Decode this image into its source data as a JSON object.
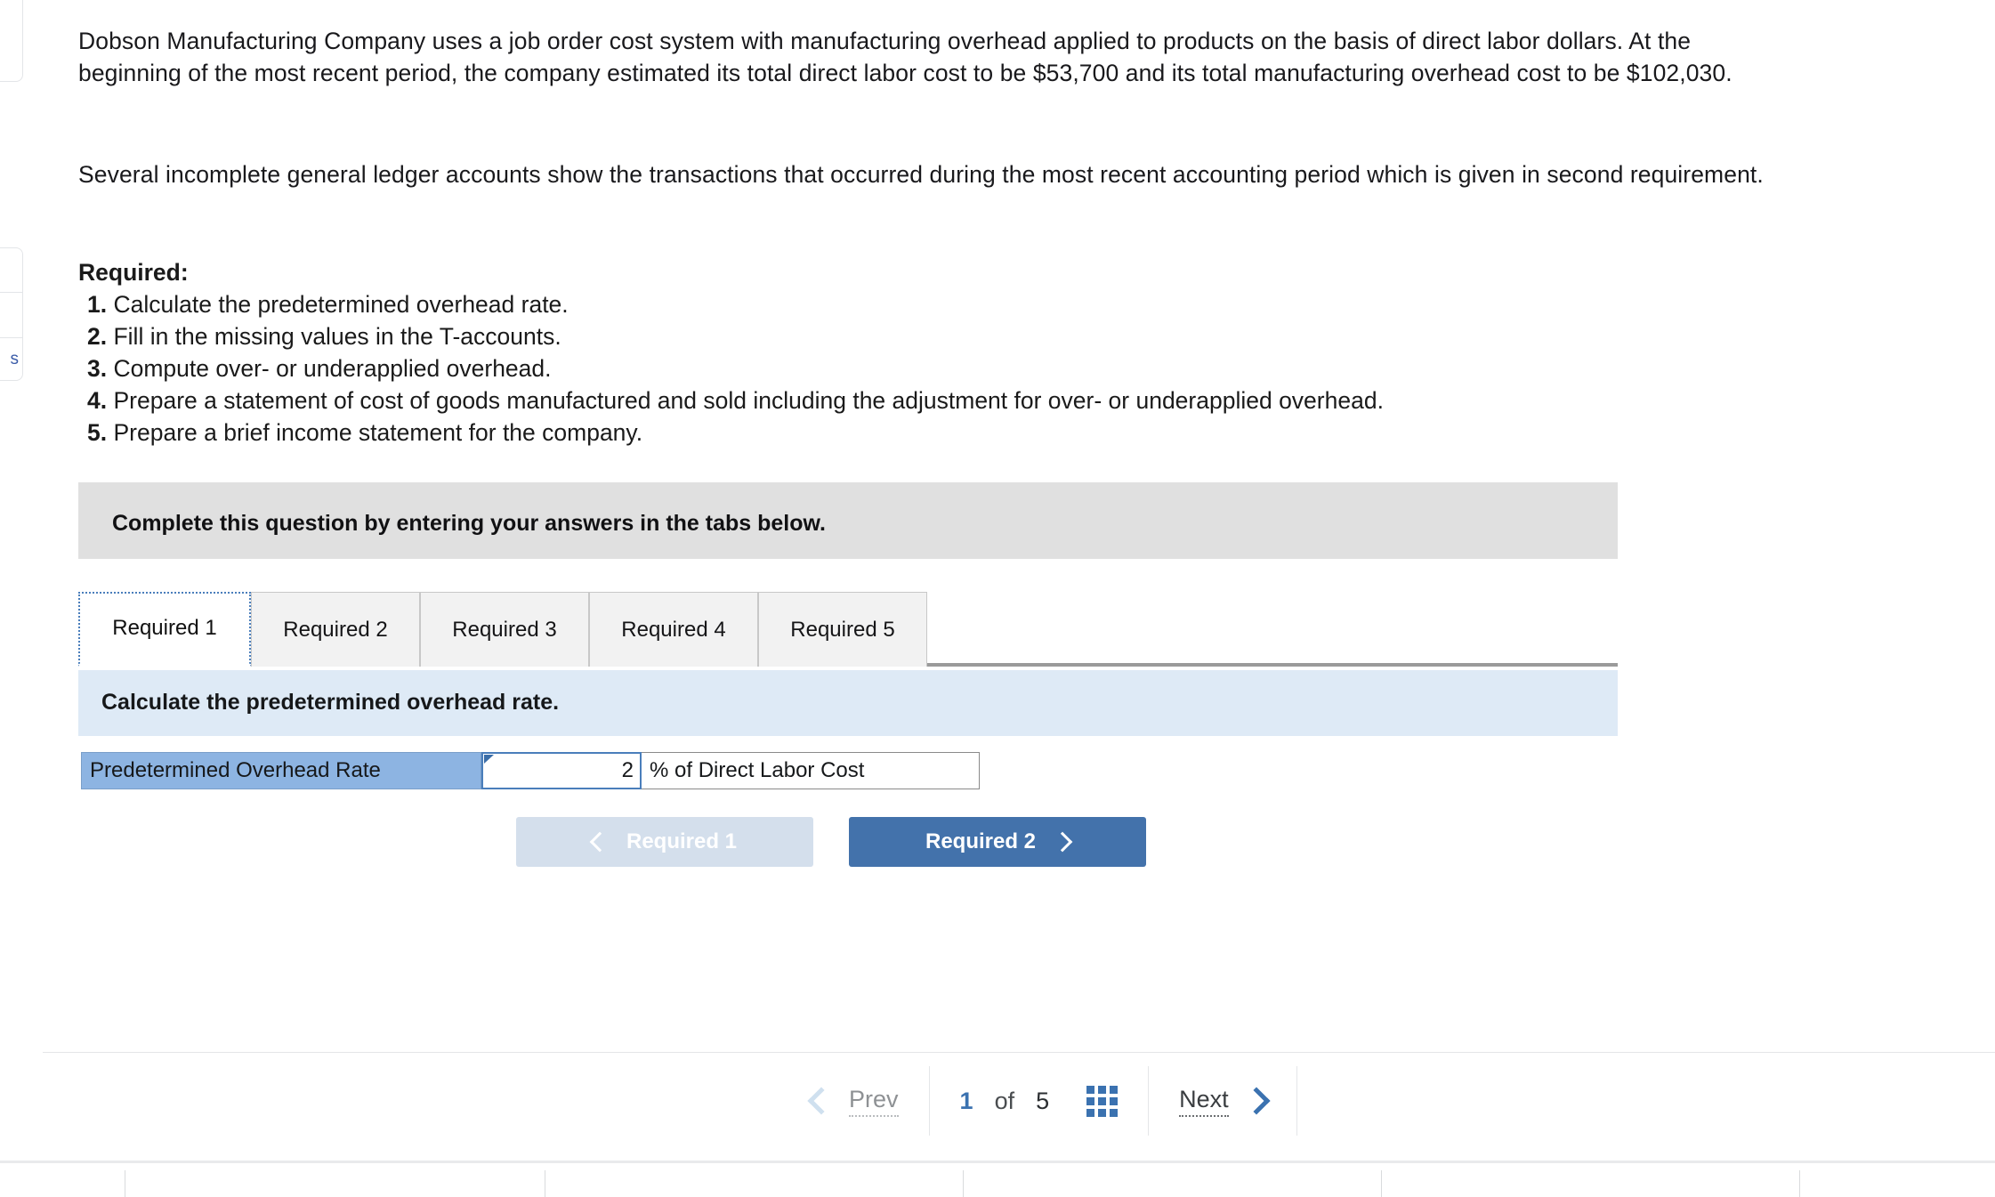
{
  "problem": {
    "intro_paragraph": "Dobson Manufacturing Company uses a job order cost system with manufacturing overhead applied to products on the basis of direct labor dollars. At the beginning of the most recent period, the company estimated its total direct labor cost to be $53,700 and its total manufacturing overhead cost to be $102,030.",
    "ledger_paragraph": "Several incomplete general ledger accounts show the transactions that occurred during the most recent accounting period which is given in second requirement.",
    "required_heading": "Required:",
    "required_items": [
      {
        "num": "1.",
        "text": "Calculate the predetermined overhead rate."
      },
      {
        "num": "2.",
        "text": "Fill in the missing values in the T-accounts."
      },
      {
        "num": "3.",
        "text": "Compute over- or underapplied overhead."
      },
      {
        "num": "4.",
        "text": "Prepare a statement of cost of goods manufactured and sold including the adjustment for over- or underapplied overhead."
      },
      {
        "num": "5.",
        "text": "Prepare a brief income statement for the company."
      }
    ]
  },
  "banner": {
    "complete_text": "Complete this question by entering your answers in the tabs below."
  },
  "tabs": [
    {
      "label": "Required 1",
      "active": true
    },
    {
      "label": "Required 2",
      "active": false
    },
    {
      "label": "Required 3",
      "active": false
    },
    {
      "label": "Required 4",
      "active": false
    },
    {
      "label": "Required 5",
      "active": false
    }
  ],
  "requirement": {
    "prompt": "Calculate the predetermined overhead rate.",
    "answer_label": "Predetermined Overhead Rate",
    "answer_value": "2",
    "answer_placeholder": "",
    "answer_unit": "% of Direct Labor Cost"
  },
  "req_nav": {
    "prev_label": "Required 1",
    "next_label": "Required 2"
  },
  "pagination": {
    "prev_label": "Prev",
    "next_label": "Next",
    "current": "1",
    "of": "of",
    "total": "5",
    "grid_icon": "grid-icon"
  },
  "edge_panel": {
    "fragment_text": "s"
  },
  "colors": {
    "accent_blue": "#4372ab",
    "label_blue": "#8db4e2",
    "prompt_blue": "#deeaf6",
    "banner_grey": "#e0e0e0",
    "link_blue": "#3b72b0"
  }
}
